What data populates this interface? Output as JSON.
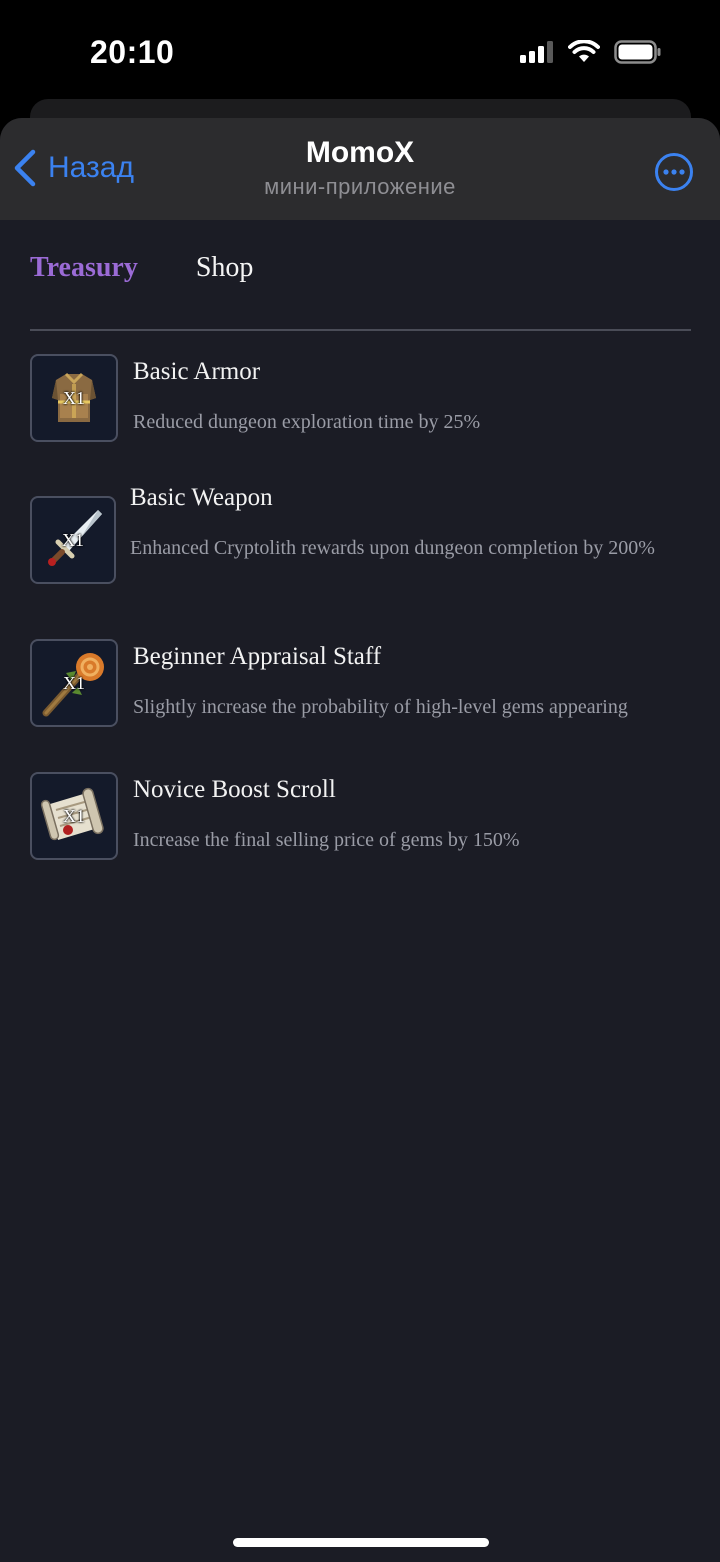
{
  "status_bar": {
    "time": "20:10"
  },
  "header": {
    "back_label": "Назад",
    "title": "MomoX",
    "subtitle": "мини-приложение"
  },
  "tabs": [
    {
      "label": "Treasury",
      "active": true
    },
    {
      "label": "Shop",
      "active": false
    }
  ],
  "items": [
    {
      "name": "Basic Armor",
      "description": "Reduced dungeon exploration time by 25%",
      "quantity": "X1",
      "icon": "armor-icon"
    },
    {
      "name": "Basic Weapon",
      "description": "Enhanced Cryptolith rewards upon dungeon completion by 200%",
      "quantity": "X1",
      "icon": "sword-icon"
    },
    {
      "name": "Beginner Appraisal Staff",
      "description": "Slightly increase the probability of high-level gems appearing",
      "quantity": "X1",
      "icon": "staff-icon"
    },
    {
      "name": "Novice Boost Scroll",
      "description": "Increase the final selling price of gems by 150%",
      "quantity": "X1",
      "icon": "scroll-icon"
    }
  ],
  "colors": {
    "accent_blue": "#3b82f0",
    "tab_active": "#9b6bd6",
    "background": "#1b1c25"
  }
}
